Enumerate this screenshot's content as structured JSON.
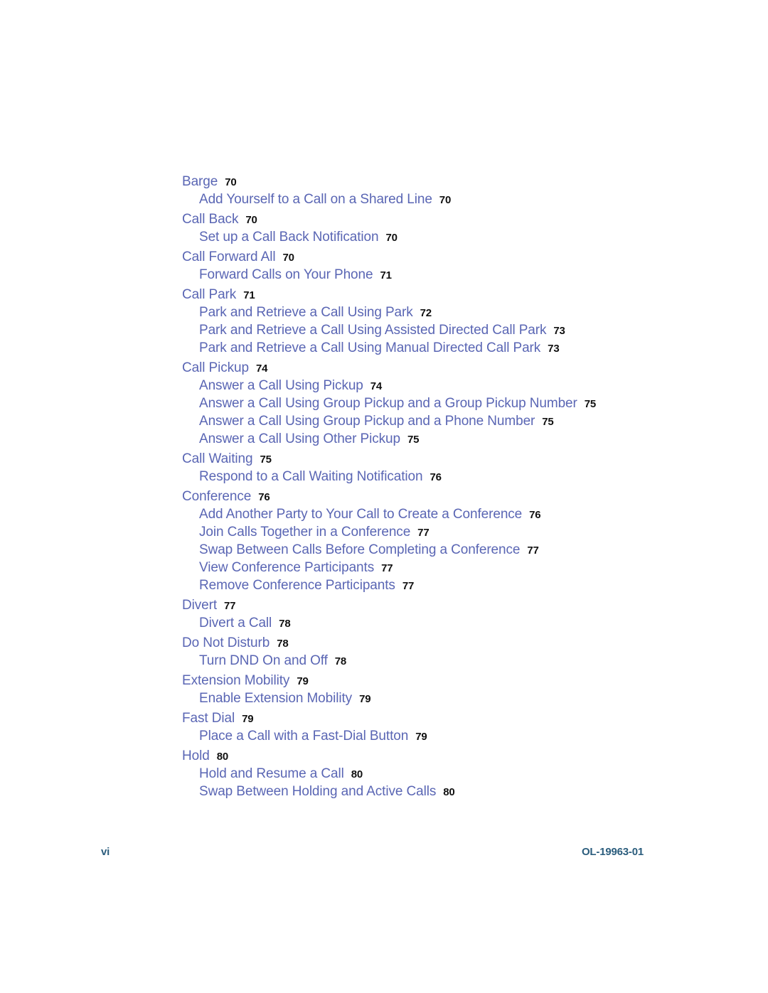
{
  "document": {
    "page_number_label": "vi",
    "document_id": "OL-19963-01",
    "accent_color": "#5a66b4",
    "page_number_color": "#111111",
    "footer_color": "#2b5d7d"
  },
  "toc": {
    "entries": [
      {
        "level": 1,
        "title": "Barge",
        "page": "70"
      },
      {
        "level": 2,
        "title": "Add Yourself to a Call on a Shared Line",
        "page": "70"
      },
      {
        "level": 1,
        "title": "Call Back",
        "page": "70"
      },
      {
        "level": 2,
        "title": "Set up a Call Back Notification",
        "page": "70"
      },
      {
        "level": 1,
        "title": "Call Forward All",
        "page": "70"
      },
      {
        "level": 2,
        "title": "Forward Calls on Your Phone",
        "page": "71"
      },
      {
        "level": 1,
        "title": "Call Park",
        "page": "71"
      },
      {
        "level": 2,
        "title": "Park and Retrieve a Call Using Park",
        "page": "72"
      },
      {
        "level": 2,
        "title": "Park and Retrieve a Call Using Assisted Directed Call Park",
        "page": "73"
      },
      {
        "level": 2,
        "title": "Park and Retrieve a Call Using Manual Directed Call Park",
        "page": "73"
      },
      {
        "level": 1,
        "title": "Call Pickup",
        "page": "74"
      },
      {
        "level": 2,
        "title": "Answer a Call Using Pickup",
        "page": "74"
      },
      {
        "level": 2,
        "title": "Answer a Call Using Group Pickup and a Group Pickup Number",
        "page": "75"
      },
      {
        "level": 2,
        "title": "Answer a Call Using Group Pickup and a Phone Number",
        "page": "75"
      },
      {
        "level": 2,
        "title": "Answer a Call Using Other Pickup",
        "page": "75"
      },
      {
        "level": 1,
        "title": "Call Waiting",
        "page": "75"
      },
      {
        "level": 2,
        "title": "Respond to a Call Waiting Notification",
        "page": "76"
      },
      {
        "level": 1,
        "title": "Conference",
        "page": "76"
      },
      {
        "level": 2,
        "title": "Add Another Party to Your Call to Create a Conference",
        "page": "76"
      },
      {
        "level": 2,
        "title": "Join Calls Together in a Conference",
        "page": "77"
      },
      {
        "level": 2,
        "title": "Swap Between Calls Before Completing a Conference",
        "page": "77"
      },
      {
        "level": 2,
        "title": "View Conference Participants",
        "page": "77"
      },
      {
        "level": 2,
        "title": "Remove Conference Participants",
        "page": "77"
      },
      {
        "level": 1,
        "title": "Divert",
        "page": "77"
      },
      {
        "level": 2,
        "title": "Divert a Call",
        "page": "78"
      },
      {
        "level": 1,
        "title": "Do Not Disturb",
        "page": "78"
      },
      {
        "level": 2,
        "title": "Turn DND On and Off",
        "page": "78"
      },
      {
        "level": 1,
        "title": "Extension Mobility",
        "page": "79"
      },
      {
        "level": 2,
        "title": "Enable Extension Mobility",
        "page": "79"
      },
      {
        "level": 1,
        "title": "Fast Dial",
        "page": "79"
      },
      {
        "level": 2,
        "title": "Place a Call with a Fast-Dial Button",
        "page": "79"
      },
      {
        "level": 1,
        "title": "Hold",
        "page": "80"
      },
      {
        "level": 2,
        "title": "Hold and Resume a Call",
        "page": "80"
      },
      {
        "level": 2,
        "title": "Swap Between Holding and Active Calls",
        "page": "80"
      }
    ]
  }
}
